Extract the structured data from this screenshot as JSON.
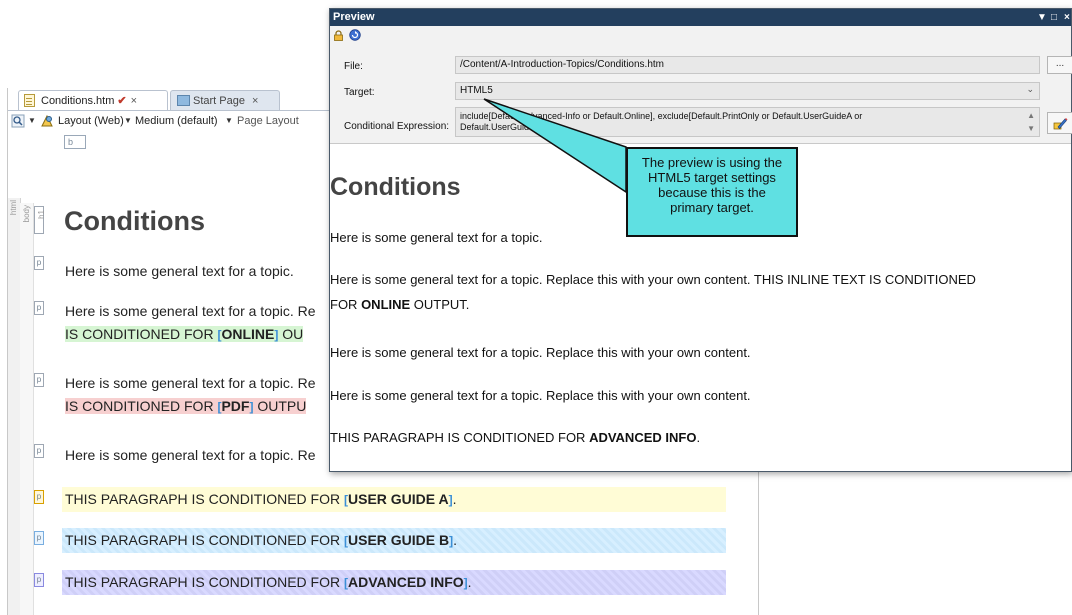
{
  "editor": {
    "tabs": [
      {
        "label": "Conditions.htm",
        "modified_mark": "✔",
        "close": "×"
      },
      {
        "label": "Start Page",
        "close": "×"
      }
    ],
    "toolbar": {
      "layout": "Layout (Web)",
      "medium": "Medium (default)",
      "page_layout": "Page Layout"
    },
    "tag_b": "b",
    "structure_labels": {
      "html": "html",
      "body": "body",
      "h1": "h1"
    },
    "para_marker": "p",
    "heading": "Conditions",
    "paragraphs": {
      "p1": "Here is some general text for a topic.",
      "p2_line1": "Here is some general text for a topic. Re",
      "p2_line2_pre": "IS CONDITIONED FOR ",
      "p2_line2_bold": "ONLINE",
      "p2_line2_post": " OU",
      "p3_line1": "Here is some general text for a topic. Re",
      "p3_line2_pre": "IS CONDITIONED FOR ",
      "p3_line2_bold": "PDF",
      "p3_line2_post": " OUTPU",
      "p4": "Here is some general text for a topic. Re",
      "p5_pre": "THIS PARAGRAPH IS CONDITIONED FOR ",
      "p5_bold": "USER GUIDE A",
      "p6_pre": "THIS PARAGRAPH IS CONDITIONED FOR ",
      "p6_bold": "USER GUIDE B",
      "p7_pre": "THIS PARAGRAPH IS CONDITIONED FOR ",
      "p7_bold": "ADVANCED INFO",
      "period": "."
    },
    "cond_bracket_open": "[",
    "cond_bracket_close": "]"
  },
  "preview": {
    "title": "Preview",
    "controls": {
      "pin": "▼",
      "maximize": "□",
      "close": "×"
    },
    "file_label": "File:",
    "file_value": "/Content/A-Introduction-Topics/Conditions.htm",
    "browse_label": "...",
    "target_label": "Target:",
    "target_value": "HTML5",
    "cond_label": "Conditional Expression:",
    "cond_value_line1": "include[Default.Advanced-Info or Default.Online], exclude[Default.PrintOnly or Default.UserGuideA or",
    "cond_value_line2": "Default.UserGuideB]",
    "heading": "Conditions",
    "p1": "Here is some general text for a topic.",
    "p2_line1": "Here is some general text for a topic. Replace this with your own content. THIS INLINE TEXT IS CONDITIONED",
    "p2_line2_pre": "FOR ",
    "p2_line2_bold": "ONLINE",
    "p2_line2_post": " OUTPUT.",
    "p3": "Here is some general text for a topic. Replace this with your own content.",
    "p4": "Here is some general text for a topic. Replace this with your own content.",
    "p5_pre": "THIS PARAGRAPH IS CONDITIONED FOR ",
    "p5_bold": "ADVANCED INFO",
    "p5_post": "."
  },
  "callout": {
    "text_lines": [
      "The preview is using the",
      "HTML5 target settings",
      "because this is the",
      "primary target."
    ]
  },
  "colors": {
    "title_bar": "#233f5e",
    "callout_fill": "#5fe0e2",
    "online_highlight": "#d6f5d3",
    "pdf_highlight": "#f7d0d0",
    "userguide_a_band": "#fffcd6",
    "userguide_b_band": "#d7efff",
    "advanced_band": "#d9d9ff"
  }
}
